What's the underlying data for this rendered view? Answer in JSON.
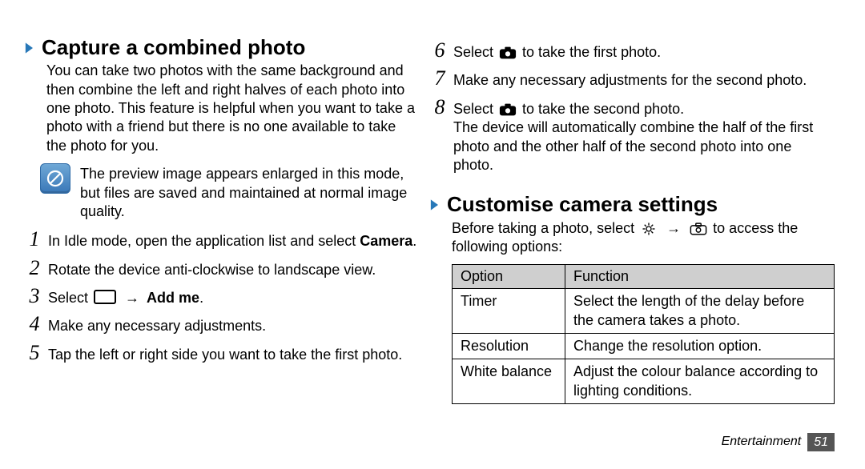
{
  "left": {
    "heading": "Capture a combined photo",
    "intro": "You can take two photos with the same background and then combine the left and right halves of each photo into one photo. This feature is helpful when you want to take a photo with a friend but there is no one available to take the photo for you.",
    "note": "The preview image appears enlarged in this mode, but files are saved and maintained at normal image quality.",
    "steps": {
      "s1_a": "In Idle mode, open the application list and select ",
      "s1_b": "Camera",
      "s1_c": ".",
      "s2": "Rotate the device anti-clockwise to landscape view.",
      "s3_a": "Select ",
      "s3_b": " → ",
      "s3_c": "Add me",
      "s3_d": ".",
      "s4": "Make any necessary adjustments.",
      "s5": "Tap the left or right side you want to take the first photo."
    }
  },
  "right": {
    "steps": {
      "s6_a": "Select ",
      "s6_b": " to take the first photo.",
      "s7": "Make any necessary adjustments for the second photo.",
      "s8_a": "Select ",
      "s8_b": " to take the second photo.",
      "s8_after": "The device will automatically combine the half of the first photo and the other half of the second photo into one photo."
    },
    "heading": "Customise camera settings",
    "intro_a": "Before taking a photo, select ",
    "intro_b": " → ",
    "intro_c": " to access the following options:",
    "table": {
      "h1": "Option",
      "h2": "Function",
      "rows": [
        {
          "opt": "Timer",
          "fn": "Select the length of the delay before the camera takes a photo."
        },
        {
          "opt": "Resolution",
          "fn": "Change the resolution option."
        },
        {
          "opt": "White balance",
          "fn": "Adjust the colour balance according to lighting conditions."
        }
      ]
    }
  },
  "footer": {
    "section": "Entertainment",
    "page": "51"
  }
}
